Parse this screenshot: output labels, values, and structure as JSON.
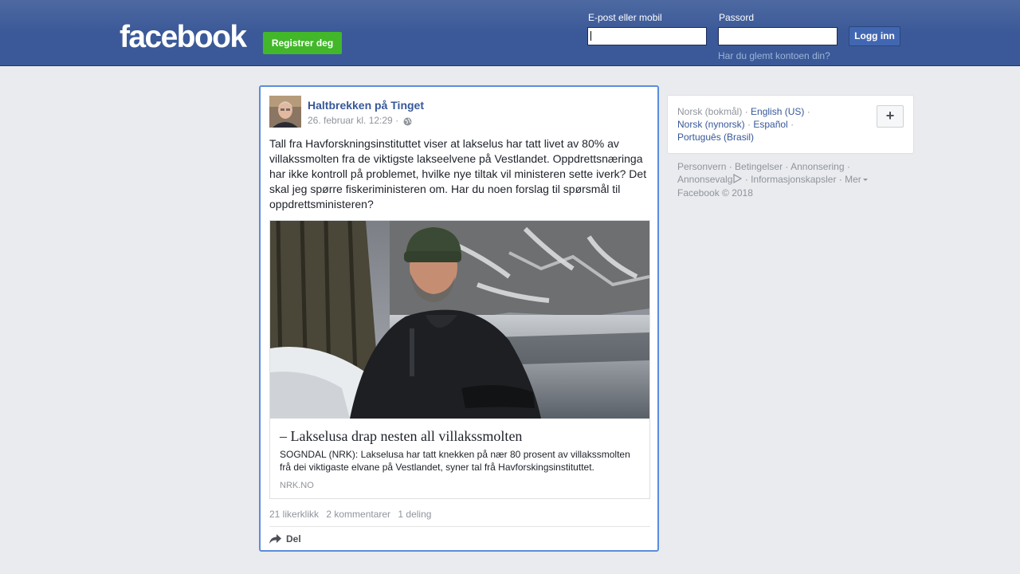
{
  "header": {
    "logo": "facebook",
    "register_label": "Registrer deg",
    "email_label": "E-post eller mobil",
    "email_value": "",
    "password_label": "Passord",
    "password_value": "",
    "login_label": "Logg inn",
    "forgot_label": "Har du glemt kontoen din?"
  },
  "post": {
    "author": "Haltbrekken på Tinget",
    "timestamp": "26. februar kl. 12:29",
    "text": "Tall fra Havforskningsinstituttet viser at lakselus har tatt livet av 80% av villakssmolten fra de viktigste lakseelvene på Vestlandet. Oppdrettsnæringa har ikke kontroll på problemet, hvilke nye tiltak vil ministeren sette iverk? Det skal jeg spørre fiskeriministeren om. Har du noen forslag til spørsmål til oppdrettsministeren?",
    "link": {
      "title": "– Lakselusa drap nesten all villakssmolten",
      "description": "SOGNDAL (NRK): Lakselusa har tatt knekken på nær 80 prosent av villakssmolten frå dei viktigaste elvane på Vestlandet, syner tal frå Havforskingsinstituttet.",
      "domain": "NRK.NO"
    },
    "stats": {
      "likes": "21 likerklikk",
      "comments": "2 kommentarer",
      "shares": "1 deling"
    },
    "share_label": "Del"
  },
  "sidebar": {
    "languages": {
      "current": "Norsk (bokmål)",
      "options": [
        "English (US)",
        "Norsk (nynorsk)",
        "Español",
        "Português (Brasil)"
      ]
    },
    "plus_label": "+",
    "footer": {
      "links": [
        "Personvern",
        "Betingelser",
        "Annonsering",
        "Annonsevalg",
        "Informasjonskapsler",
        "Mer"
      ],
      "copyright": "Facebook © 2018"
    }
  },
  "colors": {
    "brand_blue": "#3b5998",
    "link_blue": "#365899",
    "register_green": "#42b72a",
    "background": "#e9ebee"
  }
}
